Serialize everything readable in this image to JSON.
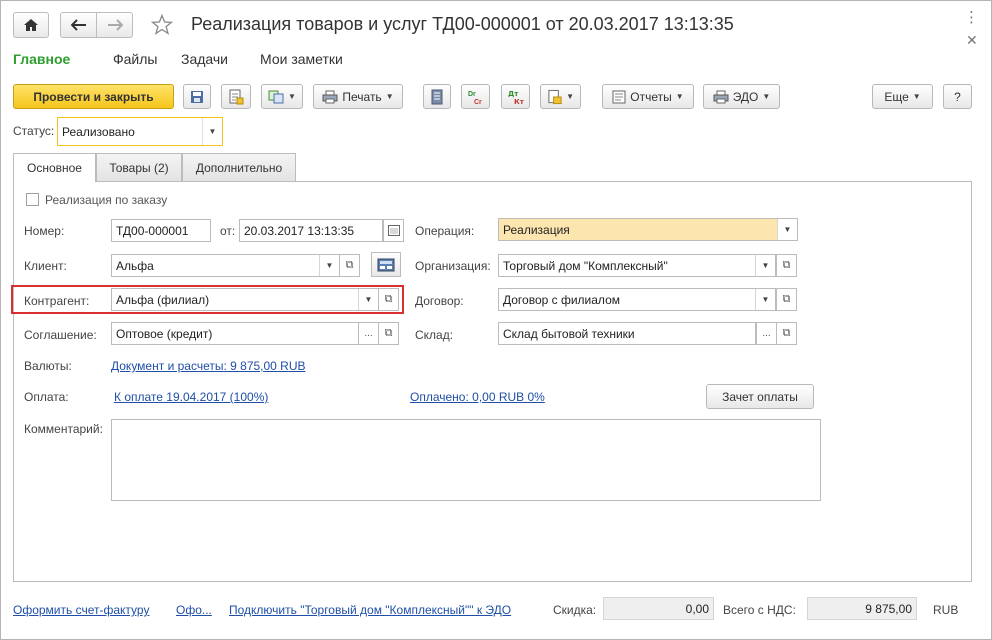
{
  "window": {
    "title": "Реализация товаров и услуг ТД00-000001 от 20.03.2017 13:13:35",
    "menu_icon": "more-vertical-icon",
    "close_icon": "close-icon"
  },
  "nav": {
    "home_icon": "home-icon",
    "back_icon": "arrow-left-icon",
    "forward_icon": "arrow-right-icon",
    "star_icon": "star-icon"
  },
  "sections": [
    "Главное",
    "Файлы",
    "Задачи",
    "Мои заметки"
  ],
  "toolbar": {
    "post_close": "Провести и закрыть",
    "print": "Печать",
    "reports": "Отчеты",
    "edo": "ЭДО",
    "more": "Еще",
    "help": "?"
  },
  "status": {
    "label": "Статус:",
    "value": "Реализовано"
  },
  "tabs": [
    "Основное",
    "Товары (2)",
    "Дополнительно"
  ],
  "form": {
    "by_order": "Реализация по заказу",
    "number_label": "Номер:",
    "number": "ТД00-000001",
    "date_label": "от:",
    "date": "20.03.2017 13:13:35",
    "operation_label": "Операция:",
    "operation": "Реализация",
    "client_label": "Клиент:",
    "client": "Альфа",
    "org_label": "Организация:",
    "org": "Торговый дом \"Комплексный\"",
    "counterparty_label": "Контрагент:",
    "counterparty": "Альфа (филиал)",
    "contract_label": "Договор:",
    "contract": "Договор с филиалом",
    "agreement_label": "Соглашение:",
    "agreement": "Оптовое (кредит)",
    "warehouse_label": "Склад:",
    "warehouse": "Склад бытовой техники",
    "currency_label": "Валюты:",
    "currency_link": "Документ и расчеты: 9 875,00 RUB",
    "payment_label": "Оплата:",
    "payment_link": "К оплате 19.04.2017 (100%)",
    "paid_link": "Оплачено: 0,00 RUB  0%",
    "offset_button": "Зачет оплаты",
    "comment_label": "Комментарий:",
    "comment": ""
  },
  "footer": {
    "invoice_link": "Оформить счет-фактуру",
    "ofo_link": "Офо...",
    "edo_link": "Подключить \"Торговый дом \"Комплексный\"\" к ЭДО",
    "discount_label": "Скидка:",
    "discount": "0,00",
    "total_label": "Всего с НДС:",
    "total": "9 875,00",
    "currency": "RUB"
  }
}
